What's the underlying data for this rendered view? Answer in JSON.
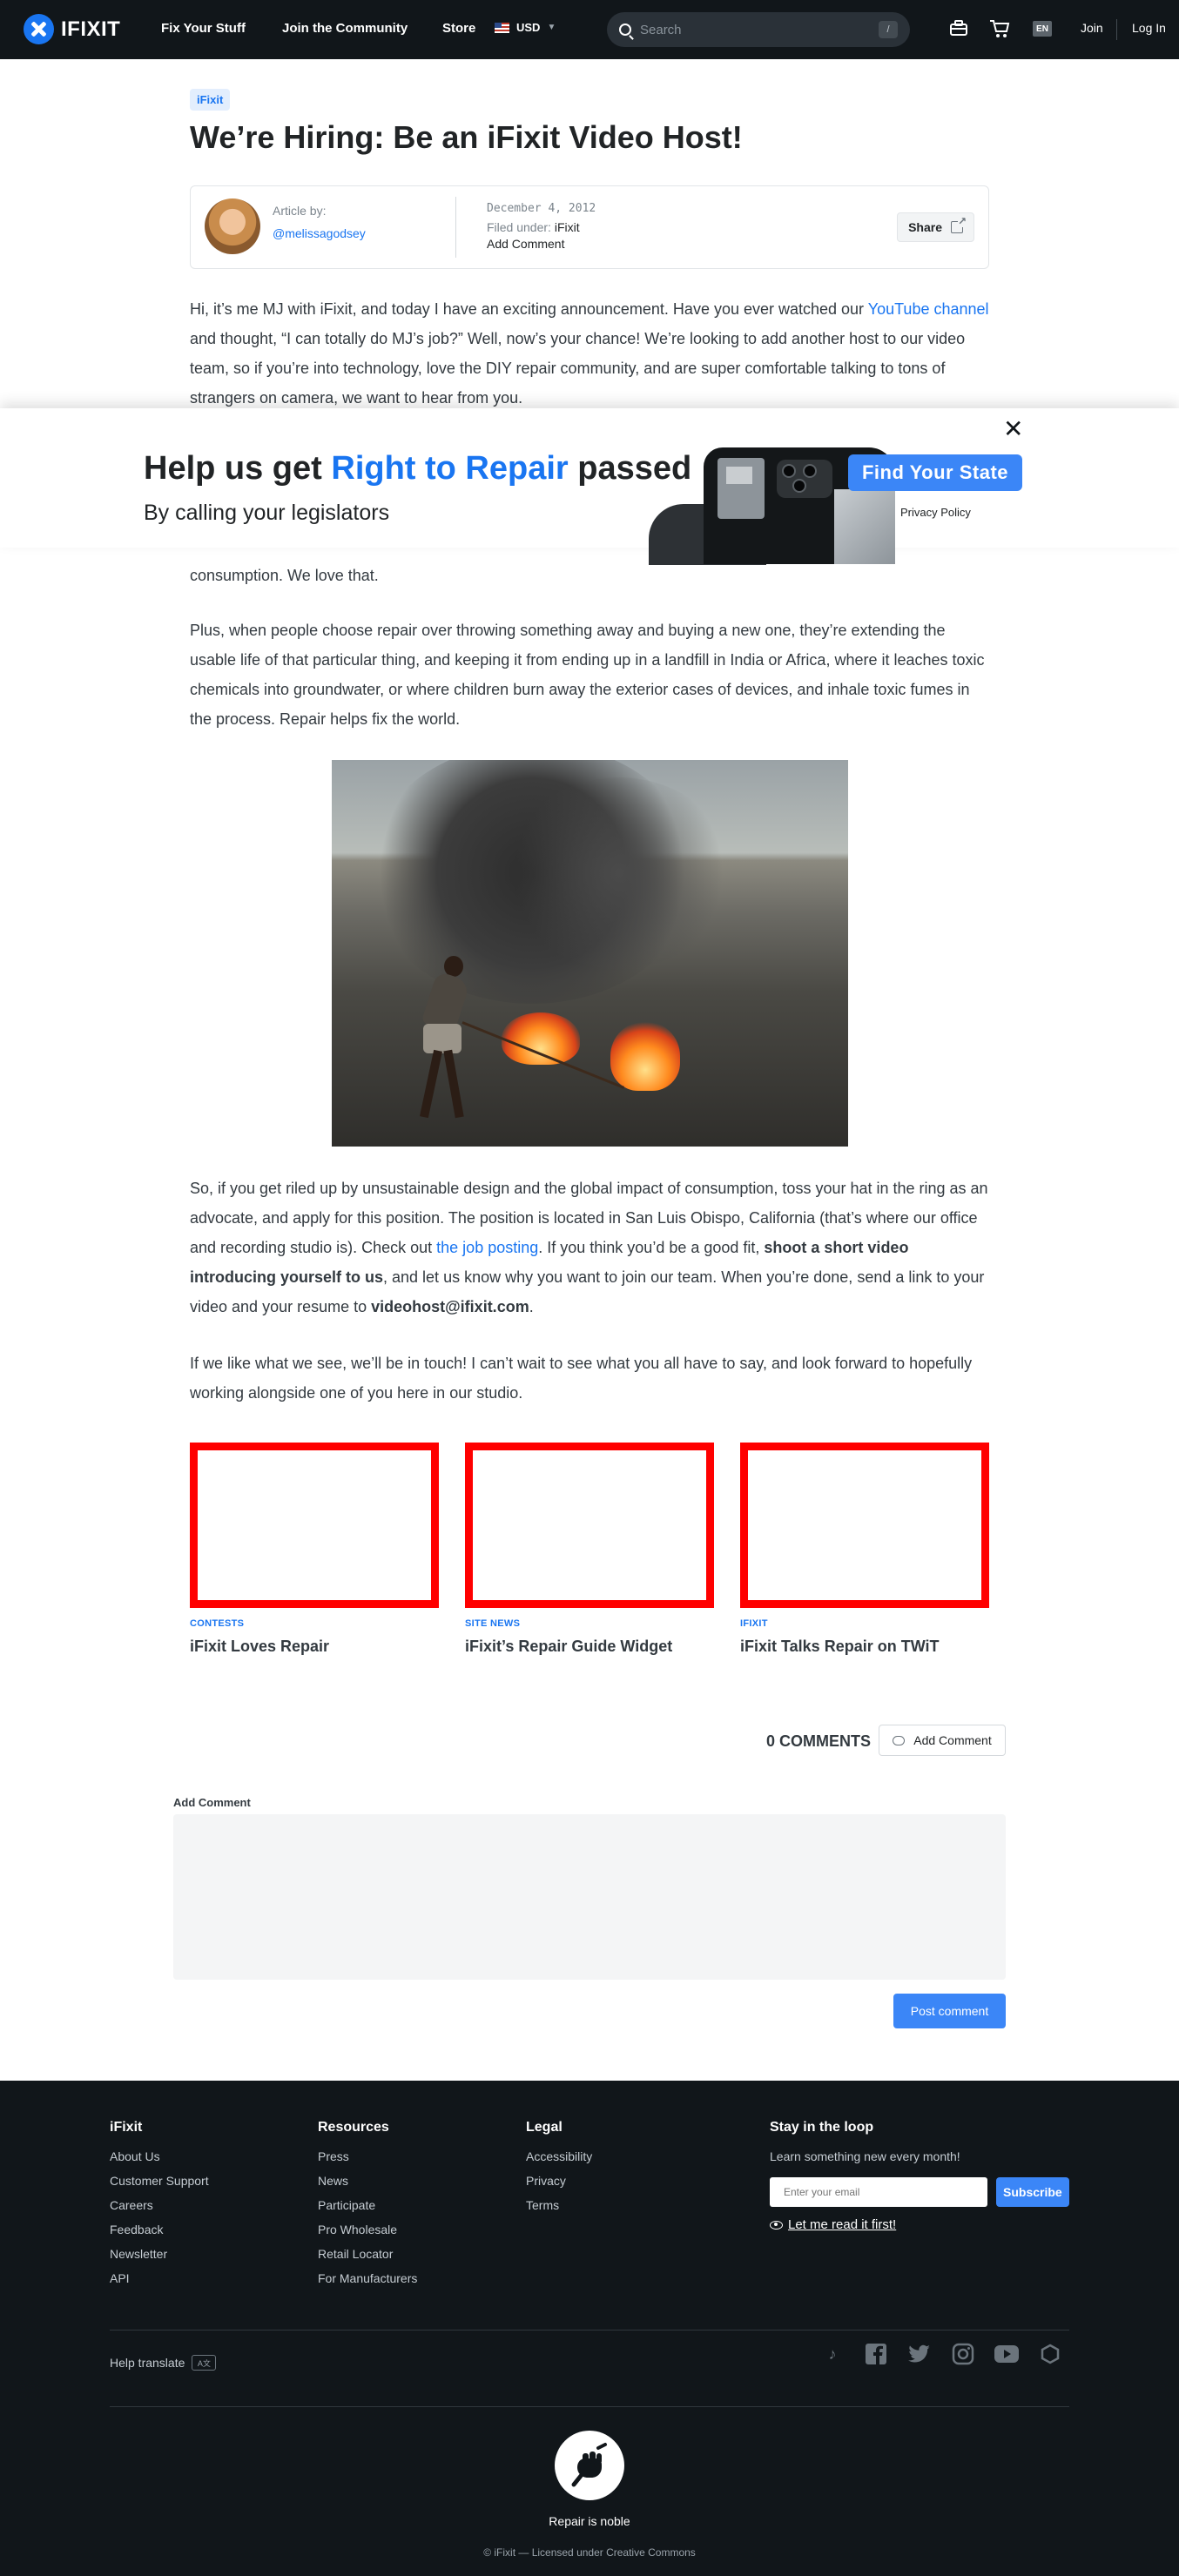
{
  "nav": {
    "brand": "IFIXIT",
    "links": [
      "Fix Your Stuff",
      "Join the Community",
      "Store"
    ],
    "currency": "USD",
    "search_placeholder": "Search",
    "search_shortcut": "/",
    "language": "EN",
    "join": "Join",
    "login": "Log In"
  },
  "article": {
    "tag": "iFixit",
    "title": "We’re Hiring: Be an iFixit Video Host!",
    "author_label": "Article by:",
    "author": "@melissagodsey",
    "date": "December 4, 2012",
    "filed_label": "Filed under:",
    "filed_value": "iFixit",
    "add_comment": "Add Comment",
    "share": "Share"
  },
  "body": {
    "p1_a": "Hi, it’s me MJ with iFixit, and today I have an exciting announcement. Have you ever watched our ",
    "p1_link": "YouTube channel",
    "p1_b": " and thought, “I can totally do MJ’s job?” Well, now’s your chance! We’re looking to add another host to our video team, so if you’re into technology, love the DIY repair community, and are super comfortable talking to tons of strangers on camera, we want to hear from you.",
    "p2_tail": "consumption. We love that.",
    "p3": "Plus, when people choose repair over throwing something away and buying a new one, they’re extending the usable life of that particular thing, and keeping it from ending up in a landfill in India or Africa, where it leaches toxic chemicals into groundwater, or where children burn away the exterior cases of devices, and inhale toxic fumes in the process. Repair helps fix the world.",
    "p4_a": "So, if you get riled up by unsustainable design and the global impact of consumption, toss your hat in the ring as an advocate, and apply for this position. The position is located in San Luis Obispo, California (that’s where our office and recording studio is). Check out ",
    "p4_link": "the job posting",
    "p4_b": ". If you think you’d be a good fit, ",
    "p4_bold1": "shoot a short video introducing yourself to us",
    "p4_c": ", and let us know why you want to join our team. When you’re done, send a link to your video and your resume to ",
    "p4_bold2": "videohost@ifixit.com",
    "p4_d": ".",
    "p5": "If we like what we see, we’ll be in touch! I can’t wait to see what you all have to say, and look forward to hopefully working alongside one of you here in our studio."
  },
  "banner": {
    "title_a": "Help us get ",
    "title_hl": "Right to Repair",
    "title_b": " passed",
    "subtitle": "By calling your legislators",
    "cta": "Find Your State",
    "privacy": "Privacy Policy",
    "close": "✕"
  },
  "related": [
    {
      "category": "Contests",
      "title": "iFixit Loves Repair"
    },
    {
      "category": "Site News",
      "title": "iFixit’s Repair Guide Widget"
    },
    {
      "category": "iFixit",
      "title": "iFixit Talks Repair on TWiT"
    }
  ],
  "comments": {
    "count": "0 COMMENTS",
    "add_button": "Add Comment",
    "add_label": "Add Comment",
    "post": "Post comment"
  },
  "footer": {
    "col1": {
      "title": "iFixit",
      "links": [
        "About Us",
        "Customer Support",
        "Careers",
        "Feedback",
        "Newsletter",
        "API"
      ]
    },
    "col2": {
      "title": "Resources",
      "links": [
        "Press",
        "News",
        "Participate",
        "Pro Wholesale",
        "Retail Locator",
        "For Manufacturers"
      ]
    },
    "col3": {
      "title": "Legal",
      "links": [
        "Accessibility",
        "Privacy",
        "Terms"
      ]
    },
    "loop": {
      "title": "Stay in the loop",
      "subtitle": "Learn something new every month!",
      "email_placeholder": "Enter your email",
      "subscribe": "Subscribe",
      "read_first": "Let me read it first!"
    },
    "help_translate": "Help translate",
    "tagline": "Repair is noble",
    "license": "© iFixit — Licensed under Creative Commons"
  }
}
